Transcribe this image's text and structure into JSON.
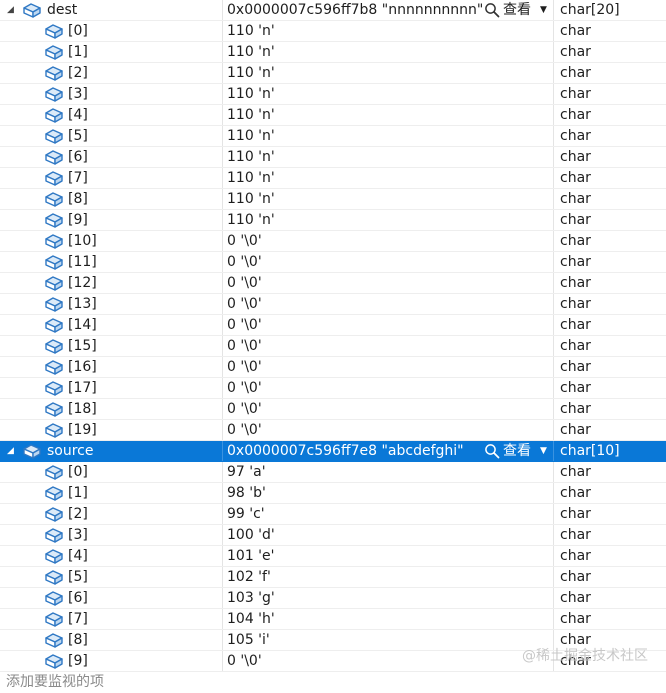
{
  "dest": {
    "expand_glyph": "◢",
    "name": "dest",
    "value": "0x0000007c596ff7b8 \"nnnnnnnnnn\"",
    "view_label": "查看",
    "type": "char[20]",
    "children": [
      {
        "name": "[0]",
        "value": "110 'n'",
        "type": "char"
      },
      {
        "name": "[1]",
        "value": "110 'n'",
        "type": "char"
      },
      {
        "name": "[2]",
        "value": "110 'n'",
        "type": "char"
      },
      {
        "name": "[3]",
        "value": "110 'n'",
        "type": "char"
      },
      {
        "name": "[4]",
        "value": "110 'n'",
        "type": "char"
      },
      {
        "name": "[5]",
        "value": "110 'n'",
        "type": "char"
      },
      {
        "name": "[6]",
        "value": "110 'n'",
        "type": "char"
      },
      {
        "name": "[7]",
        "value": "110 'n'",
        "type": "char"
      },
      {
        "name": "[8]",
        "value": "110 'n'",
        "type": "char"
      },
      {
        "name": "[9]",
        "value": "110 'n'",
        "type": "char"
      },
      {
        "name": "[10]",
        "value": "0 '\\0'",
        "type": "char"
      },
      {
        "name": "[11]",
        "value": "0 '\\0'",
        "type": "char"
      },
      {
        "name": "[12]",
        "value": "0 '\\0'",
        "type": "char"
      },
      {
        "name": "[13]",
        "value": "0 '\\0'",
        "type": "char"
      },
      {
        "name": "[14]",
        "value": "0 '\\0'",
        "type": "char"
      },
      {
        "name": "[15]",
        "value": "0 '\\0'",
        "type": "char"
      },
      {
        "name": "[16]",
        "value": "0 '\\0'",
        "type": "char"
      },
      {
        "name": "[17]",
        "value": "0 '\\0'",
        "type": "char"
      },
      {
        "name": "[18]",
        "value": "0 '\\0'",
        "type": "char"
      },
      {
        "name": "[19]",
        "value": "0 '\\0'",
        "type": "char"
      }
    ]
  },
  "source": {
    "expand_glyph": "◢",
    "name": "source",
    "value": "0x0000007c596ff7e8 \"abcdefghi\"",
    "view_label": "查看",
    "type": "char[10]",
    "children": [
      {
        "name": "[0]",
        "value": "97 'a'",
        "type": "char"
      },
      {
        "name": "[1]",
        "value": "98 'b'",
        "type": "char"
      },
      {
        "name": "[2]",
        "value": "99 'c'",
        "type": "char"
      },
      {
        "name": "[3]",
        "value": "100 'd'",
        "type": "char"
      },
      {
        "name": "[4]",
        "value": "101 'e'",
        "type": "char"
      },
      {
        "name": "[5]",
        "value": "102 'f'",
        "type": "char"
      },
      {
        "name": "[6]",
        "value": "103 'g'",
        "type": "char"
      },
      {
        "name": "[7]",
        "value": "104 'h'",
        "type": "char"
      },
      {
        "name": "[8]",
        "value": "105 'i'",
        "type": "char"
      },
      {
        "name": "[9]",
        "value": "0 '\\0'",
        "type": "char"
      }
    ]
  },
  "footer": {
    "add_watch_placeholder": "添加要监视的项"
  },
  "watermark": "@稀土掘金技术社区",
  "colors": {
    "selection": "#0a78d7",
    "icon_blue": "#2f78c4"
  }
}
